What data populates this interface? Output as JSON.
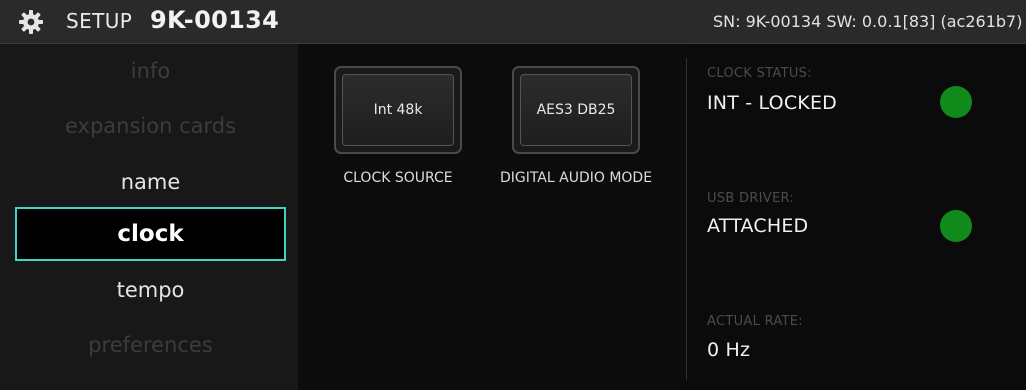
{
  "header": {
    "title_label": "SETUP",
    "title_id": "9K-00134",
    "serial_info": "SN: 9K-00134 SW: 0.0.1[83] (ac261b7)",
    "icon": "gear-icon"
  },
  "sidebar": {
    "items": [
      {
        "label": "info",
        "state": "disabled"
      },
      {
        "label": "expansion cards",
        "state": "disabled"
      },
      {
        "label": "name",
        "state": "enabled"
      },
      {
        "label": "clock",
        "state": "selected"
      },
      {
        "label": "tempo",
        "state": "enabled"
      },
      {
        "label": "preferences",
        "state": "disabled"
      }
    ]
  },
  "controls": {
    "clock_source": {
      "value": "Int 48k",
      "caption": "CLOCK SOURCE"
    },
    "digital_audio_mode": {
      "value": "AES3 DB25",
      "caption": "DIGITAL AUDIO MODE"
    }
  },
  "status": {
    "clock_status": {
      "label": "CLOCK STATUS:",
      "value": "INT - LOCKED",
      "led": "green"
    },
    "usb_driver": {
      "label": "USB DRIVER:",
      "value": "ATTACHED",
      "led": "green"
    },
    "actual_rate": {
      "label": "ACTUAL RATE:",
      "value": "0 Hz"
    }
  },
  "colors": {
    "accent": "#3fd3c3",
    "led_green": "#118a1c",
    "header_bg": "#2a2a2a",
    "sidebar_bg": "#181818"
  }
}
